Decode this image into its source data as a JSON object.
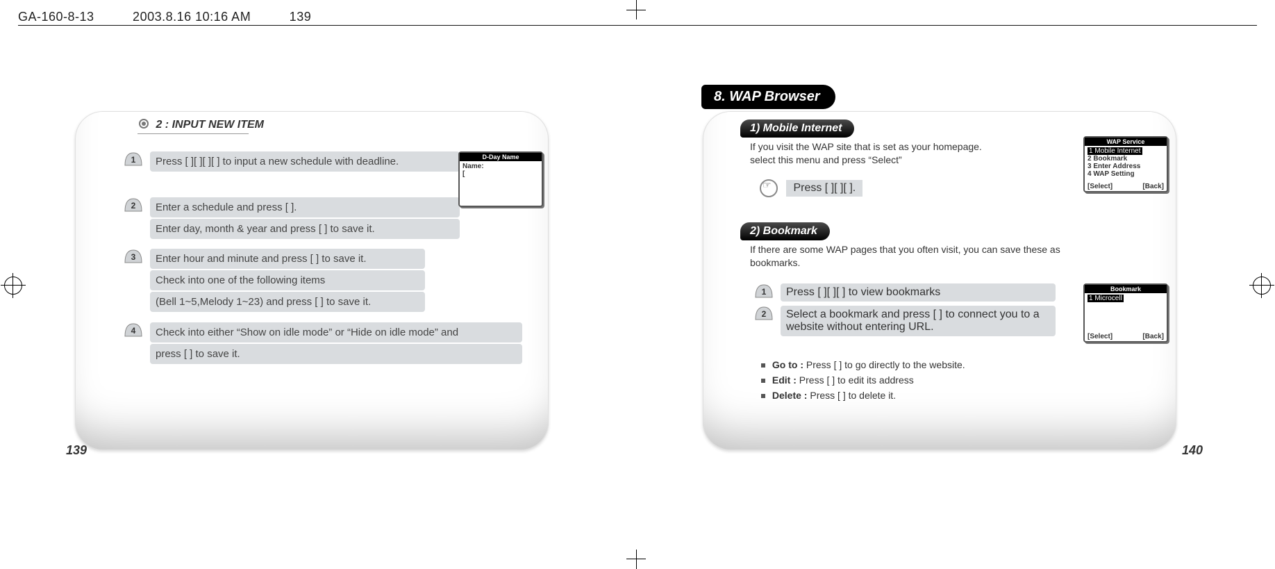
{
  "header": {
    "print_line": "GA-160-8-13　　　2003.8.16 10:16 AM　　　139"
  },
  "left_page": {
    "number": "139",
    "section_title": "2 : INPUT NEW ITEM",
    "steps": {
      "1": "Press [        ][        ][        ][        ] to input a new schedule with deadline.",
      "2_line1": "Enter a schedule and press [        ].",
      "2_line2": "Enter day, month & year and press [        ] to save it.",
      "3_line1": "Enter hour and minute and press [        ] to save it.",
      "3_line2": "Check into one of the following items",
      "3_line3": "(Bell 1~5,Melody 1~23) and press [        ] to save it.",
      "4_line1": "Check into either “Show on idle mode” or “Hide on idle mode” and",
      "4_line2": "press [        ] to save it."
    },
    "lcd": {
      "title": "D-Day Name",
      "name_label": "Name:",
      "cursor": "["
    }
  },
  "right_page": {
    "number": "140",
    "chapter": "8. WAP Browser",
    "sec1": {
      "heading": "1) Mobile Internet",
      "intro1": "If you visit the WAP site that is set as your homepage.",
      "intro2": "select this menu and press “Select”",
      "press": "Press [        ][        ][        ]."
    },
    "sec2": {
      "heading": "2) Bookmark",
      "intro": "If there are some WAP pages that you often visit,  you can save these as bookmarks.",
      "step1": "Press [        ][        ][        ] to view bookmarks",
      "step2": "Select a bookmark and press [        ] to connect you to a website without entering URL.",
      "goto_label": "Go to :",
      "goto_text": "Press [        ] to go directly to the website.",
      "edit_label": "Edit :",
      "edit_text": "Press [        ] to edit its address",
      "delete_label": "Delete :",
      "delete_text": "Press [        ] to delete it."
    },
    "wap_lcd": {
      "title": "WAP Service",
      "items": {
        "1": "1 Mobile Internet",
        "2": "2 Bookmark",
        "3": "3 Enter Address",
        "4": "4 WAP Setting"
      },
      "soft_left": "[Select]",
      "soft_right": "[Back]"
    },
    "bookmark_lcd": {
      "title": "Bookmark",
      "item1": "1 Microcell",
      "soft_left": "[Select]",
      "soft_right": "[Back]"
    }
  }
}
